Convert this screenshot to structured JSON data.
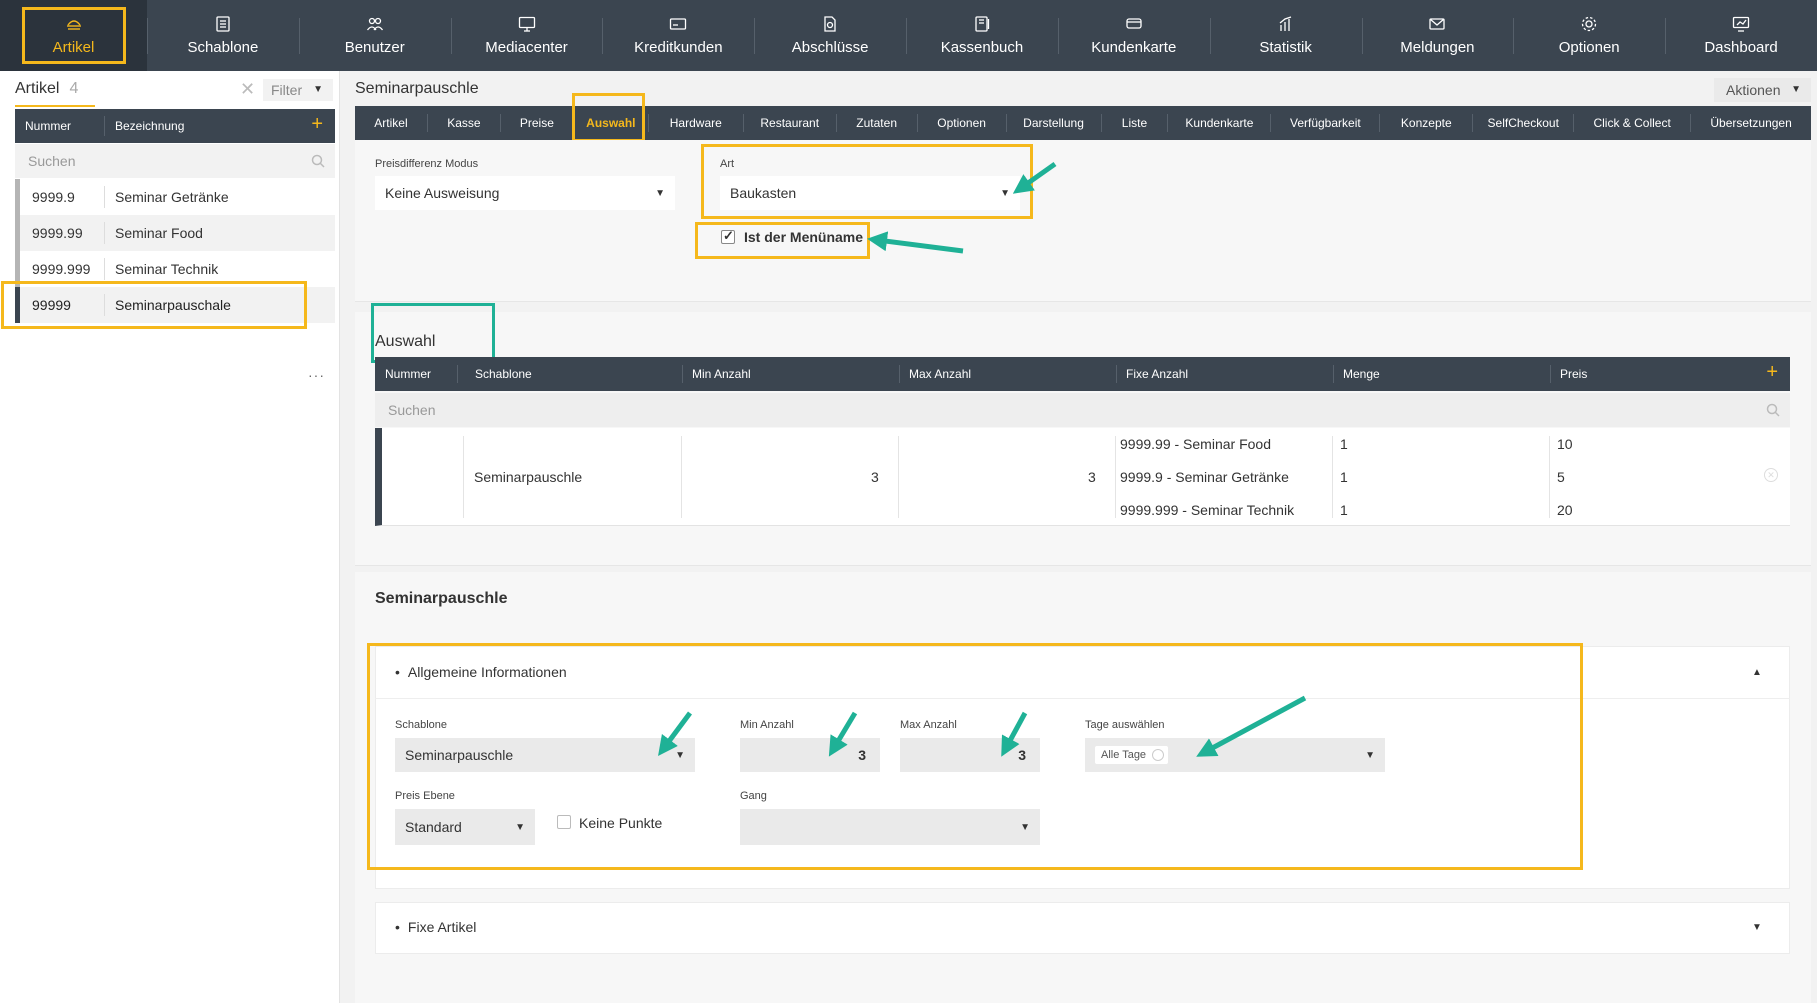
{
  "topnav": {
    "items": [
      {
        "label": "Artikel",
        "icon": "artikel-icon"
      },
      {
        "label": "Schablone",
        "icon": "template-icon"
      },
      {
        "label": "Benutzer",
        "icon": "users-icon"
      },
      {
        "label": "Mediacenter",
        "icon": "monitor-icon"
      },
      {
        "label": "Kreditkunden",
        "icon": "credit-card-icon"
      },
      {
        "label": "Abschlüsse",
        "icon": "document-icon"
      },
      {
        "label": "Kassenbuch",
        "icon": "book-icon"
      },
      {
        "label": "Kundenkarte",
        "icon": "card-icon"
      },
      {
        "label": "Statistik",
        "icon": "chart-icon"
      },
      {
        "label": "Meldungen",
        "icon": "mail-icon"
      },
      {
        "label": "Optionen",
        "icon": "gear-icon"
      },
      {
        "label": "Dashboard",
        "icon": "dashboard-icon"
      }
    ],
    "active_color": "#f5b81c"
  },
  "left": {
    "title": "Artikel",
    "count": "4",
    "filter_label": "Filter",
    "col_number": "Nummer",
    "col_name": "Bezeichnung",
    "search_placeholder": "Suchen",
    "rows": [
      {
        "num": "9999.9",
        "name": "Seminar Getränke"
      },
      {
        "num": "9999.99",
        "name": "Seminar Food"
      },
      {
        "num": "9999.999",
        "name": "Seminar Technik"
      },
      {
        "num": "99999",
        "name": "Seminarpauschale"
      }
    ],
    "more": "···"
  },
  "main": {
    "title": "Seminarpauschle",
    "actions_label": "Aktionen",
    "tabs": [
      "Artikel",
      "Kasse",
      "Preise",
      "Auswahl",
      "Hardware",
      "Restaurant",
      "Zutaten",
      "Optionen",
      "Darstellung",
      "Liste",
      "Kundenkarte",
      "Verfügbarkeit",
      "Konzepte",
      "SelfCheckout",
      "Click & Collect",
      "Übersetzungen"
    ],
    "active_tab": "Auswahl"
  },
  "settings": {
    "price_mode_label": "Preisdifferenz Modus",
    "price_mode_value": "Keine Ausweisung",
    "art_label": "Art",
    "art_value": "Baukasten",
    "menu_name_label": "Ist der Menüname",
    "menu_name_checked": true
  },
  "auswahl": {
    "title": "Auswahl",
    "columns": [
      "Nummer",
      "Schablone",
      "Min Anzahl",
      "Max Anzahl",
      "Fixe Anzahl",
      "Menge",
      "Preis"
    ],
    "search_placeholder": "Suchen",
    "row": {
      "schablone": "Seminarpauschle",
      "min": "3",
      "max": "3",
      "fixe": [
        "9999.99 - Seminar Food",
        "9999.9 - Seminar Getränke",
        "9999.999 - Seminar Technik"
      ],
      "menge": [
        "1",
        "1",
        "1"
      ],
      "preis": [
        "10",
        "5",
        "20"
      ]
    }
  },
  "detail": {
    "title": "Seminarpauschle",
    "general_title": "Allgemeine Informationen",
    "schablone_label": "Schablone",
    "schablone_value": "Seminarpauschle",
    "min_label": "Min Anzahl",
    "min_value": "3",
    "max_label": "Max Anzahl",
    "max_value": "3",
    "days_label": "Tage auswählen",
    "days_value": "Alle Tage",
    "price_level_label": "Preis Ebene",
    "price_level_value": "Standard",
    "no_points_label": "Keine Punkte",
    "course_label": "Gang",
    "course_value": "",
    "fixed_articles_title": "Fixe Artikel"
  },
  "annotation_colors": {
    "highlight": "#f5b81c",
    "arrow": "#1fb196"
  }
}
